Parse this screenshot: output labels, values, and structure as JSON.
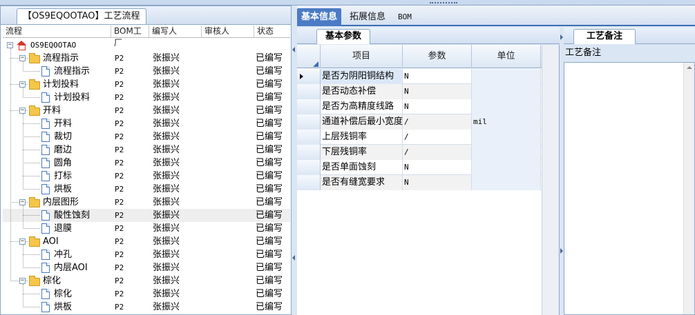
{
  "left_panel": {
    "tab_label": "【OS9EQOOTAO】工艺流程",
    "columns": [
      "流程",
      "BOM工厂",
      "编写人",
      "审核人",
      "状态"
    ],
    "rows": [
      {
        "name": "OS9EQOOTAO",
        "bom": "",
        "writer": "",
        "reviewer": "",
        "status": "",
        "level": 0,
        "type": "root"
      },
      {
        "name": "流程指示",
        "bom": "P2",
        "writer": "张振兴",
        "reviewer": "",
        "status": "已编写",
        "level": 1,
        "type": "folder"
      },
      {
        "name": "流程指示",
        "bom": "P2",
        "writer": "张振兴",
        "reviewer": "",
        "status": "已编写",
        "level": 2,
        "type": "doc"
      },
      {
        "name": "计划投料",
        "bom": "P2",
        "writer": "张振兴",
        "reviewer": "",
        "status": "已编写",
        "level": 1,
        "type": "folder"
      },
      {
        "name": "计划投料",
        "bom": "P2",
        "writer": "张振兴",
        "reviewer": "",
        "status": "已编写",
        "level": 2,
        "type": "doc"
      },
      {
        "name": "开料",
        "bom": "P2",
        "writer": "张振兴",
        "reviewer": "",
        "status": "已编写",
        "level": 1,
        "type": "folder"
      },
      {
        "name": "开料",
        "bom": "P2",
        "writer": "张振兴",
        "reviewer": "",
        "status": "已编写",
        "level": 2,
        "type": "doc"
      },
      {
        "name": "裁切",
        "bom": "P2",
        "writer": "张振兴",
        "reviewer": "",
        "status": "已编写",
        "level": 2,
        "type": "doc"
      },
      {
        "name": "磨边",
        "bom": "P2",
        "writer": "张振兴",
        "reviewer": "",
        "status": "已编写",
        "level": 2,
        "type": "doc"
      },
      {
        "name": "圆角",
        "bom": "P2",
        "writer": "张振兴",
        "reviewer": "",
        "status": "已编写",
        "level": 2,
        "type": "doc"
      },
      {
        "name": "打标",
        "bom": "P2",
        "writer": "张振兴",
        "reviewer": "",
        "status": "已编写",
        "level": 2,
        "type": "doc"
      },
      {
        "name": "烘板",
        "bom": "P2",
        "writer": "张振兴",
        "reviewer": "",
        "status": "已编写",
        "level": 2,
        "type": "doc"
      },
      {
        "name": "内层图形",
        "bom": "P2",
        "writer": "张振兴",
        "reviewer": "",
        "status": "已编写",
        "level": 1,
        "type": "folder"
      },
      {
        "name": "酸性蚀刻",
        "bom": "P2",
        "writer": "张振兴",
        "reviewer": "",
        "status": "已编写",
        "level": 2,
        "type": "doc",
        "selected": true
      },
      {
        "name": "退膜",
        "bom": "P2",
        "writer": "张振兴",
        "reviewer": "",
        "status": "已编写",
        "level": 2,
        "type": "doc"
      },
      {
        "name": "AOI",
        "bom": "P2",
        "writer": "张振兴",
        "reviewer": "",
        "status": "已编写",
        "level": 1,
        "type": "folder"
      },
      {
        "name": "冲孔",
        "bom": "P2",
        "writer": "张振兴",
        "reviewer": "",
        "status": "已编写",
        "level": 2,
        "type": "doc"
      },
      {
        "name": "内层AOI",
        "bom": "P2",
        "writer": "张振兴",
        "reviewer": "",
        "status": "已编写",
        "level": 2,
        "type": "doc"
      },
      {
        "name": "棕化",
        "bom": "P2",
        "writer": "张振兴",
        "reviewer": "",
        "status": "已编写",
        "level": 1,
        "type": "folder"
      },
      {
        "name": "棕化",
        "bom": "P2",
        "writer": "张振兴",
        "reviewer": "",
        "status": "已编写",
        "level": 2,
        "type": "doc"
      },
      {
        "name": "烘板",
        "bom": "P2",
        "writer": "张振兴",
        "reviewer": "",
        "status": "已编写",
        "level": 2,
        "type": "doc"
      }
    ]
  },
  "main_tabs": [
    {
      "label": "基本信息",
      "active": true
    },
    {
      "label": "拓展信息",
      "active": false
    },
    {
      "label": "BOM",
      "active": false
    }
  ],
  "params": {
    "subtab_label": "基本参数",
    "columns": [
      "项目",
      "参数",
      "单位"
    ],
    "rows": [
      {
        "item": "是否为阴阳铜结构",
        "value": "N",
        "unit": ""
      },
      {
        "item": "是否动态补偿",
        "value": "N",
        "unit": ""
      },
      {
        "item": "是否为高精度线路",
        "value": "N",
        "unit": ""
      },
      {
        "item": "通道补偿后最小宽度",
        "value": "/",
        "unit": "mil"
      },
      {
        "item": "上层残铜率",
        "value": "/",
        "unit": ""
      },
      {
        "item": "下层残铜率",
        "value": "/",
        "unit": ""
      },
      {
        "item": "是否单面蚀刻",
        "value": "N",
        "unit": ""
      },
      {
        "item": "是否有缝宽要求",
        "value": "N",
        "unit": ""
      }
    ]
  },
  "remarks": {
    "tab_label": "工艺备注",
    "field_label": "工艺备注",
    "content": ""
  },
  "colors": {
    "active_tab": "#4a7bc4",
    "panel_border": "#8aa6c9",
    "background": "#dbe6f4"
  }
}
